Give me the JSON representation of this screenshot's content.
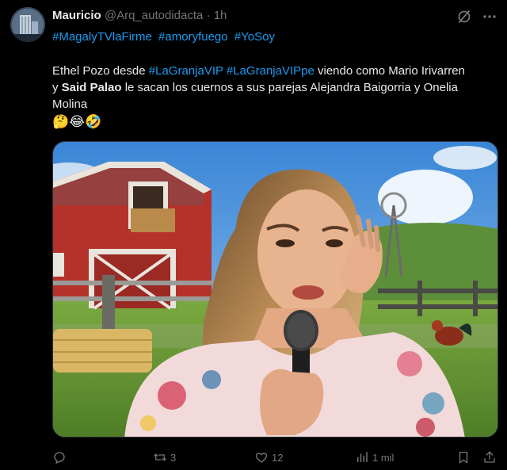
{
  "author": {
    "name": "Mauricio",
    "handle": "@Arq_autodidacta",
    "separator": "·",
    "time": "1h"
  },
  "hashtags": [
    "#MagalyTVlaFirme",
    "#amoryfuego",
    "#YoSoy"
  ],
  "body": {
    "part1": "Ethel Pozo desde ",
    "link1": "#LaGranjaVIP",
    "space": " ",
    "link2": "#LaGranjaVIPpe",
    "part2": "  viendo como Mario Irivarren y ",
    "bold_name": "Said Palao",
    "part3": " le sacan los cuernos a sus parejas Alejandra Baigorria y Onelia Molina"
  },
  "emojis": "🤔😂🤣",
  "actions": {
    "reply_count": "",
    "retweet_count": "3",
    "like_count": "12",
    "views_count": "1 mil"
  },
  "icons": {
    "top_right_1": "grok-slash-icon",
    "top_right_2": "more-icon",
    "reply": "reply-icon",
    "retweet": "retweet-icon",
    "like": "heart-icon",
    "views": "views-icon",
    "bookmark": "bookmark-icon",
    "share": "share-icon"
  },
  "colors": {
    "background": "#000000",
    "text": "#e7e9ea",
    "muted": "#71767b",
    "link": "#1d9bf0"
  }
}
